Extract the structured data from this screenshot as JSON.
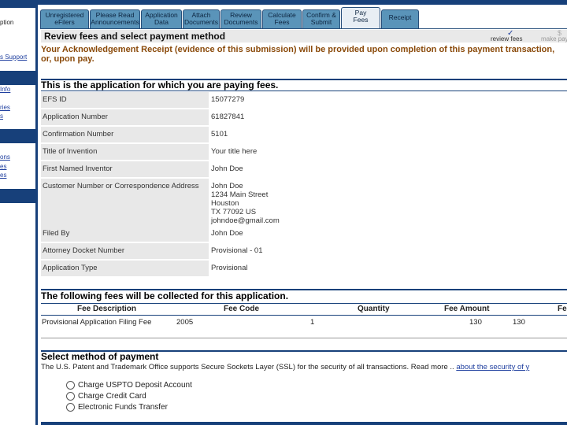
{
  "sidebar": {
    "items": [
      {
        "label": "ption",
        "type": "text"
      },
      {
        "label": "s Support",
        "type": "link"
      },
      {
        "label": "Info",
        "type": "link"
      },
      {
        "label": "ries",
        "type": "link"
      },
      {
        "label": "s",
        "type": "link"
      },
      {
        "label": "ons",
        "type": "link"
      },
      {
        "label": "es",
        "type": "link"
      },
      {
        "label": "es",
        "type": "link"
      }
    ]
  },
  "tabs": [
    {
      "label": "Unregistered\neFilers",
      "active": false
    },
    {
      "label": "Please Read\nAnnouncements",
      "active": false
    },
    {
      "label": "Application\nData",
      "active": false
    },
    {
      "label": "Attach\nDocuments",
      "active": false
    },
    {
      "label": "Review\nDocuments",
      "active": false
    },
    {
      "label": "Calculate\nFees",
      "active": false
    },
    {
      "label": "Confirm &\nSubmit",
      "active": false
    },
    {
      "label": "Pay\nFees",
      "active": true
    },
    {
      "label": "Receipt",
      "active": false
    }
  ],
  "header": {
    "title": "Review fees and select payment method",
    "steps": [
      "review fees",
      "make pay"
    ]
  },
  "notice": "Your Acknowledgement Receipt (evidence of this submission) will be provided upon completion of this payment transaction, or, upon pay.",
  "application": {
    "title": "This is the application for which you are paying fees.",
    "rows": [
      {
        "label": "EFS ID",
        "value": "15077279"
      },
      {
        "label": "Application Number",
        "value": "61827841"
      },
      {
        "label": "Confirmation Number",
        "value": "5101"
      },
      {
        "label": "Title of Invention",
        "value": "Your title here"
      },
      {
        "label": "First Named Inventor",
        "value": "John Doe"
      },
      {
        "label": "Customer Number or Correspondence Address",
        "value": "John Doe\n1234 Main Street\nHouston\nTX 77092 US\njohndoe@gmail.com"
      },
      {
        "label": "Filed By",
        "value": "John Doe"
      },
      {
        "label": "Attorney Docket Number",
        "value": "Provisional - 01"
      },
      {
        "label": "Application Type",
        "value": "Provisional"
      }
    ]
  },
  "fees": {
    "title": "The following fees will be collected for this application.",
    "columns": [
      "Fee Description",
      "Fee Code",
      "Quantity",
      "Fee Amount",
      "Fe"
    ],
    "rows": [
      {
        "description": "Provisional Application Filing Fee",
        "code": "2005",
        "quantity": "1",
        "amount": "130",
        "total": "130"
      }
    ]
  },
  "payment": {
    "title": "Select method of payment",
    "info": "The U.S. Patent and Trademark Office supports Secure Sockets Layer (SSL) for the security of all transactions. Read more ..",
    "link": "about the security of y",
    "options": [
      "Charge USPTO Deposit Account",
      "Charge Credit Card",
      "Electronic Funds Transfer"
    ]
  },
  "colors": {
    "navy": "#17407a",
    "tab": "#5a94b9",
    "notice": "#8a4a0a",
    "label_bg": "#e8e8e8"
  }
}
